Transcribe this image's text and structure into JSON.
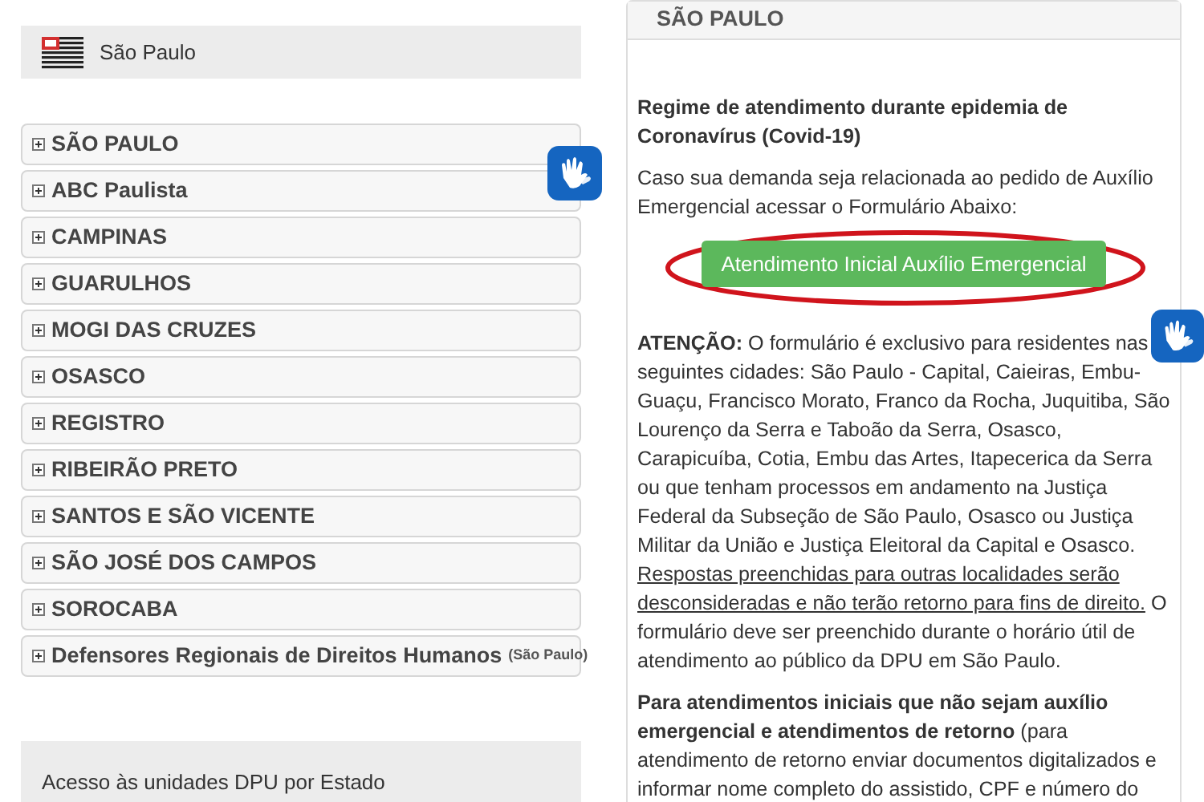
{
  "left": {
    "state_selector": {
      "label": "São Paulo"
    },
    "regions": [
      {
        "label": "SÃO PAULO",
        "expanded": false
      },
      {
        "label": "ABC Paulista",
        "expanded": false
      },
      {
        "label": "CAMPINAS",
        "expanded": false
      },
      {
        "label": "GUARULHOS",
        "expanded": false
      },
      {
        "label": "MOGI DAS CRUZES",
        "expanded": false
      },
      {
        "label": "OSASCO",
        "expanded": false
      },
      {
        "label": "REGISTRO",
        "expanded": false
      },
      {
        "label": "RIBEIRÃO PRETO",
        "expanded": false
      },
      {
        "label": "SANTOS E SÃO VICENTE",
        "expanded": false
      },
      {
        "label": "SÃO JOSÉ DOS CAMPOS",
        "expanded": false
      },
      {
        "label": "SOROCABA",
        "expanded": false
      },
      {
        "label": "Defensores Regionais de Direitos Humanos",
        "note": "(São Paulo)",
        "expanded": false
      }
    ],
    "footer_box": {
      "label": "Acesso às unidades DPU por Estado"
    }
  },
  "right": {
    "section_title": "SÃO PAULO",
    "notice_title": "Regime de atendimento durante epidemia de Coronavírus (Covid-19)",
    "intro": "Caso sua demanda seja relacionada ao pedido de Auxílio Emergencial acessar o Formulário Abaixo:",
    "button": "Atendimento Inicial Auxílio Emergencial",
    "paragraphs": [
      [
        {
          "text": "**ATENÇÃO:** O formulário é exclusivo para residentes nas seguintes cidades: São Paulo - Capital, Caieiras, Embu-Guaçu, Francisco Morato, Franco da Rocha, Juquitiba, São Lourenço da Serra e Taboão da Serra, Osasco, Carapicuíba, Cotia, Embu das Artes, Itapecerica da Serra ou que tenham processos em andamento na Justiça Federal da Subseção de São Paulo, Osasco ou Justiça Militar da União e Justiça Eleitoral da Capital e Osasco. ",
          "underline": false
        },
        {
          "text": "Respostas preenchidas para outras localidades serão desconsideradas e não terão retorno para fins de direito.",
          "underline": true
        },
        {
          "text": " O formulário deve ser preenchido durante o horário útil de atendimento ao público da DPU em São Paulo.",
          "underline": false
        }
      ],
      [
        {
          "text": "**Para atendimentos iniciais que não sejam auxílio emergencial e atendimentos de retorno** (para atendimento de retorno enviar documentos digitalizados e informar nome completo do assistido, CPF e número do",
          "underline": false
        }
      ]
    ]
  }
}
